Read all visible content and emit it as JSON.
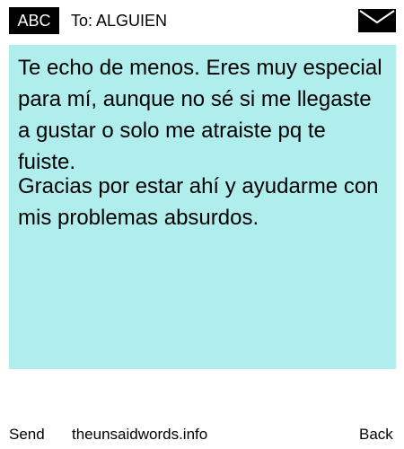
{
  "header": {
    "mode_label": "ABC",
    "to_text": "To: ALGUIEN",
    "compose_icon": "envelope-icon"
  },
  "message": {
    "paragraphs": [
      "Te echo de menos. Eres muy especial para mí, aunque no sé si me llegaste a gustar o solo me atraiste pq te fuiste.",
      "Gracias por estar ahí y ayudarme con mis problemas absurdos."
    ],
    "background_color": "#b0eeee"
  },
  "footer": {
    "send_label": "Send",
    "site_label": "theunsaidwords.info",
    "back_label": "Back"
  }
}
